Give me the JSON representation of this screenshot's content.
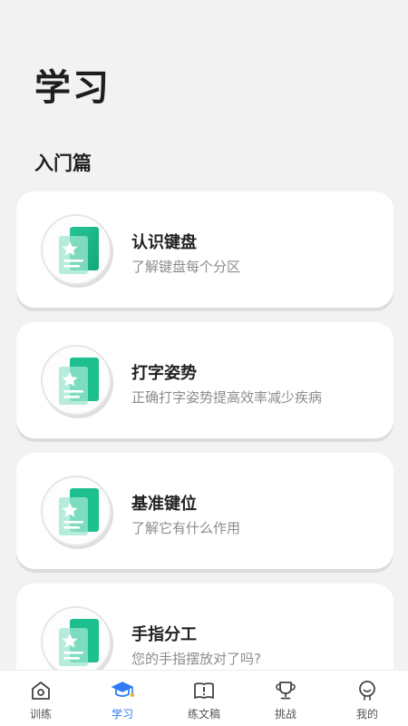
{
  "page": {
    "title": "学习",
    "section_title": "入门篇"
  },
  "cards": [
    {
      "title": "认识键盘",
      "subtitle": "了解键盘每个分区"
    },
    {
      "title": "打字姿势",
      "subtitle": "正确打字姿势提高效率减少疾病"
    },
    {
      "title": "基准键位",
      "subtitle": "了解它有什么作用"
    },
    {
      "title": "手指分工",
      "subtitle": "您的手指摆放对了吗?"
    }
  ],
  "tabbar": {
    "active": "学习",
    "tabs": [
      {
        "label": "训练",
        "icon": "home-icon"
      },
      {
        "label": "学习",
        "icon": "graduation-cap-icon"
      },
      {
        "label": "练文稿",
        "icon": "book-alert-icon"
      },
      {
        "label": "挑战",
        "icon": "trophy-icon"
      },
      {
        "label": "我的",
        "icon": "user-icon"
      }
    ]
  },
  "colors": {
    "accent": "#2f7bf5",
    "card_icon": "#1dbf8e",
    "badge": "#f5a623"
  }
}
